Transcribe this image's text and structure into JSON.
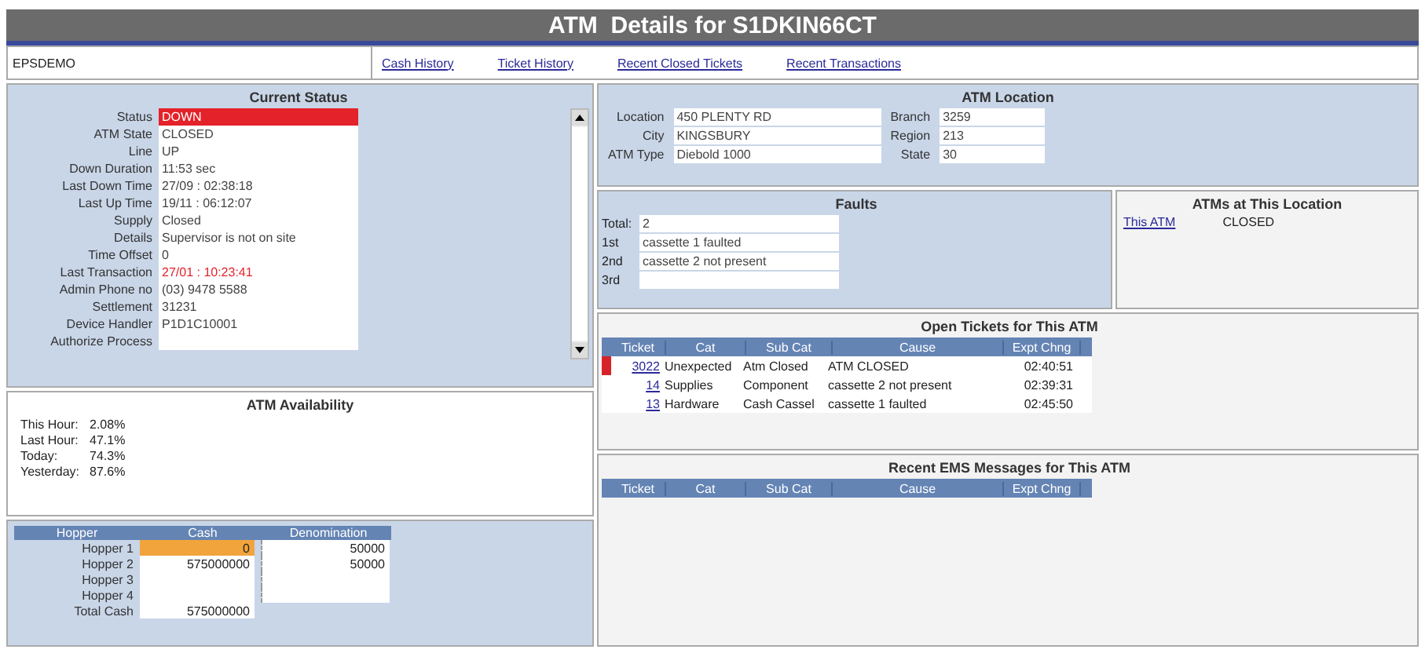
{
  "window": {
    "title": "ATM  Details for S1DKIN66CT"
  },
  "nav": {
    "user": "EPSDEMO",
    "links": [
      "Cash History",
      "Ticket History",
      "Recent Closed Tickets",
      "Recent Transactions"
    ]
  },
  "current_status": {
    "title": "Current Status",
    "fields": [
      {
        "label": "Status",
        "value": "DOWN",
        "kind": "alert"
      },
      {
        "label": "ATM State",
        "value": "CLOSED",
        "kind": "normal"
      },
      {
        "label": "Line",
        "value": "UP",
        "kind": "normal"
      },
      {
        "label": "Down Duration",
        "value": "11:53 sec",
        "kind": "normal"
      },
      {
        "label": "Last Down Time",
        "value": "27/09 : 02:38:18",
        "kind": "normal"
      },
      {
        "label": "Last Up Time",
        "value": "19/11 : 06:12:07",
        "kind": "normal"
      },
      {
        "label": "Supply",
        "value": "Closed",
        "kind": "normal"
      },
      {
        "label": "Details",
        "value": "Supervisor is not on site",
        "kind": "normal"
      },
      {
        "label": "Time Offset",
        "value": "0",
        "kind": "normal"
      },
      {
        "label": "Last Transaction",
        "value": "27/01 : 10:23:41",
        "kind": "warning"
      },
      {
        "label": "Admin Phone no",
        "value": "(03) 9478 5588",
        "kind": "normal"
      },
      {
        "label": "Settlement",
        "value": "31231",
        "kind": "normal"
      },
      {
        "label": "Device Handler",
        "value": "P1D1C10001",
        "kind": "normal"
      },
      {
        "label": "Authorize Process",
        "kind": "normal"
      }
    ]
  },
  "availability": {
    "title": "ATM Availability",
    "rows": [
      {
        "label": "This Hour:",
        "value": "2.08%"
      },
      {
        "label": "Last Hour:",
        "value": "47.1%"
      },
      {
        "label": "Today:",
        "value": "74.3%"
      },
      {
        "label": "Yesterday:",
        "value": "87.6%"
      }
    ]
  },
  "hoppers": {
    "columns": [
      "Hopper",
      "Cash",
      "Denomination"
    ],
    "rows": [
      {
        "label": "Hopper 1",
        "cash": "0",
        "denomination": "50000",
        "selected": true
      },
      {
        "label": "Hopper 2",
        "cash": "575000000",
        "denomination": "50000",
        "selected": false
      },
      {
        "label": "Hopper 3",
        "selected": false
      },
      {
        "label": "Hopper 4",
        "selected": false
      }
    ],
    "total": {
      "label": "Total Cash",
      "cash": "575000000"
    }
  },
  "location": {
    "title": "ATM Location",
    "left": [
      {
        "label": "Location",
        "value": "450 PLENTY RD"
      },
      {
        "label": "City",
        "value": "KINGSBURY"
      },
      {
        "label": "ATM Type",
        "value": "Diebold 1000"
      }
    ],
    "right": [
      {
        "label": "Branch",
        "value": "3259"
      },
      {
        "label": "Region",
        "value": "213"
      },
      {
        "label": "State",
        "value": "30"
      }
    ]
  },
  "faults": {
    "title": "Faults",
    "rows": [
      {
        "label": "Total:",
        "value": "2"
      },
      {
        "label": "1st",
        "value": "cassette 1 faulted"
      },
      {
        "label": "2nd",
        "value": "cassette 2 not present"
      },
      {
        "label": "3rd"
      }
    ]
  },
  "atms_here": {
    "title": "ATMs at This Location",
    "items": [
      {
        "link": "This ATM",
        "state": "CLOSED"
      }
    ]
  },
  "open_tickets": {
    "title": "Open Tickets for This ATM",
    "columns": [
      "Ticket",
      "Cat",
      "Sub Cat",
      "Cause",
      "Expt Chng"
    ],
    "rows": [
      {
        "ticket": "3022",
        "cat": "Unexpected",
        "sub_cat": "Atm Closed",
        "cause": "ATM CLOSED",
        "expt": "02:40:51",
        "flagged": true
      },
      {
        "ticket": "14",
        "cat": "Supplies",
        "sub_cat": "Component",
        "cause": "cassette 2 not present",
        "expt": "02:39:31",
        "flagged": false
      },
      {
        "ticket": "13",
        "cat": "Hardware",
        "sub_cat": "Cash Cassel",
        "cause": "cassette 1 faulted",
        "expt": "02:45:50",
        "flagged": false
      }
    ]
  },
  "ems": {
    "title": "Recent EMS Messages for This ATM",
    "columns": [
      "Ticket",
      "Cat",
      "Sub Cat",
      "Cause",
      "Expt Chng"
    ]
  }
}
